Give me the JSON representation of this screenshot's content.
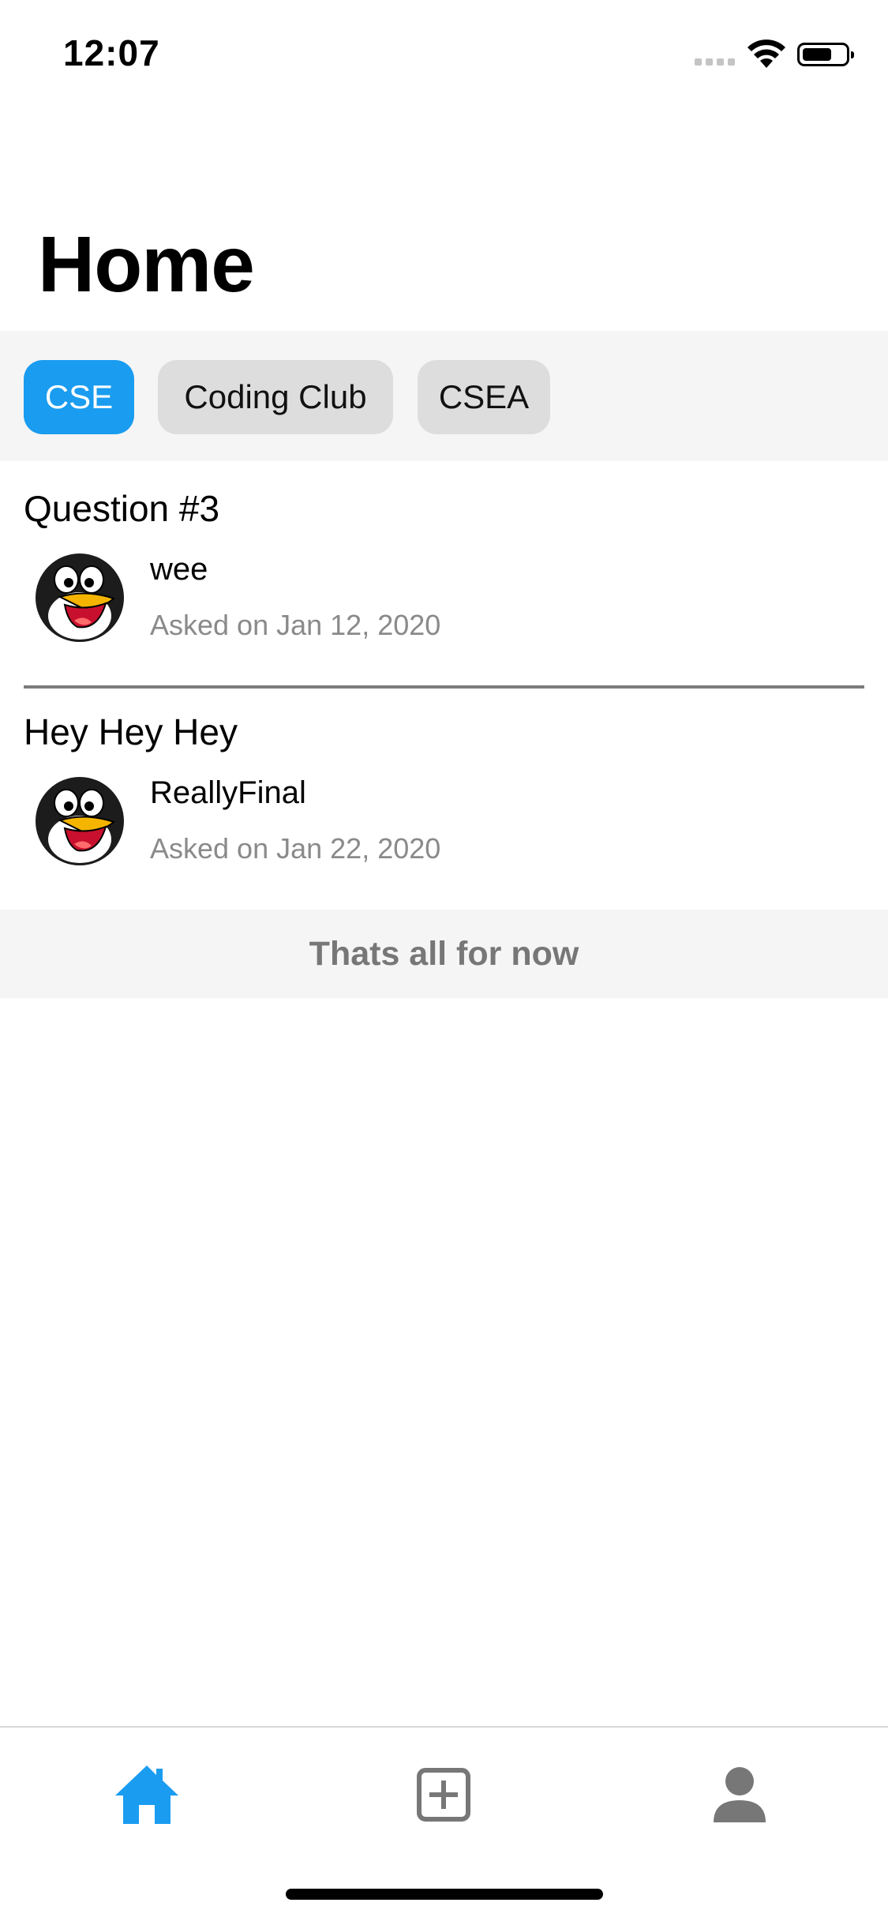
{
  "status_bar": {
    "time": "12:07",
    "battery_level": 0.7
  },
  "header": {
    "title": "Home"
  },
  "filters": {
    "items": [
      {
        "label": "CSE",
        "active": true
      },
      {
        "label": "Coding Club",
        "active": false
      },
      {
        "label": "CSEA",
        "active": false
      }
    ]
  },
  "questions": [
    {
      "title": "Question #3",
      "user": "wee",
      "date": "Asked on Jan 12, 2020"
    },
    {
      "title": "Hey Hey Hey",
      "user": "ReallyFinal",
      "date": "Asked on Jan 22, 2020"
    }
  ],
  "end_message": "Thats all for now",
  "tab_bar": {
    "tabs": [
      {
        "icon": "home-icon",
        "active": true
      },
      {
        "icon": "add-square-icon",
        "active": false
      },
      {
        "icon": "profile-icon",
        "active": false
      }
    ]
  },
  "colors": {
    "accent": "#1a9cf0",
    "inactive_icon": "#777777",
    "chip_inactive": "#dddddd",
    "divider": "#7c7c7c"
  }
}
